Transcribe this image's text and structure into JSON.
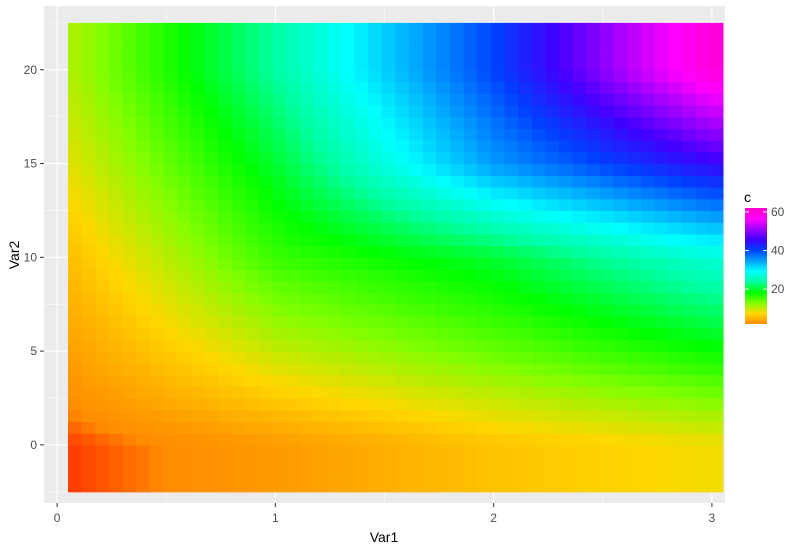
{
  "chart_data": {
    "type": "heatmap",
    "title": "",
    "xlabel": "Var1",
    "ylabel": "Var2",
    "xlim": [
      -0.06,
      3.06
    ],
    "ylim": [
      -3.1,
      23.4
    ],
    "x_ticks": [
      0,
      1,
      2,
      3
    ],
    "y_ticks": [
      0,
      5,
      10,
      15,
      20
    ],
    "x_tick_labels": [
      "0",
      "1",
      "2",
      "3"
    ],
    "y_tick_labels": [
      "0",
      "5",
      "10",
      "15",
      "20"
    ],
    "x_grid": [
      0,
      0.5,
      1,
      1.5,
      2,
      2.5,
      3
    ],
    "y_grid": [
      -2.5,
      0,
      2.5,
      5,
      7.5,
      10,
      12.5,
      15,
      17.5,
      20,
      22.5
    ],
    "grid": true,
    "tile_extent": {
      "x": [
        0.05,
        3.05
      ],
      "y": [
        -2.5,
        22.5
      ]
    },
    "x_values": [
      0,
      1,
      2,
      3
    ],
    "y_values": [
      0,
      5,
      10,
      15,
      20
    ],
    "z": [
      [
        1,
        3,
        6,
        8
      ],
      [
        3,
        10,
        14,
        18
      ],
      [
        5,
        16,
        20,
        27
      ],
      [
        8,
        20,
        35,
        45
      ],
      [
        10,
        24,
        40,
        60
      ]
    ],
    "legend": {
      "title": "c",
      "position": "right",
      "min": 2,
      "max": 62,
      "ticks": [
        20,
        40,
        60
      ],
      "tick_labels": [
        "20",
        "40",
        "60"
      ]
    },
    "colors": {
      "panel_background": "#ebebeb",
      "grid_major": "#ffffff",
      "gradient_stops": [
        "#ff8c00",
        "#ffd700",
        "#7fff00",
        "#00ff00",
        "#00ffa0",
        "#00ffff",
        "#00a0ff",
        "#0040ff",
        "#4000ff",
        "#a000ff",
        "#ff00ff",
        "#ff00c8"
      ]
    }
  }
}
